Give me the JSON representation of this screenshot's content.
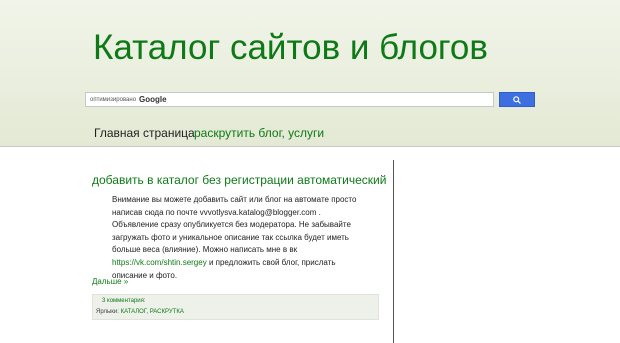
{
  "header": {
    "site_title": "Каталог сайтов и блогов",
    "search": {
      "hint": "оптимизировано",
      "brand": "Google"
    },
    "nav": [
      {
        "label": "Главная страница"
      },
      {
        "label": "раскрутить блог, услуги"
      }
    ]
  },
  "post": {
    "title": "добавить в каталог без регистрации автоматический",
    "body_text": "Внимание вы можете добавить сайт или блог на автомате просто написав сюда по почте vvvotlysva.katalog@blogger.com . Объявление сразу опубликуется без модератора. Не забывайте загружать фото и уникальное описание так ссылка будет иметь больше веса (влияние). Можно написать мне в вк",
    "vk_link": "https://vk.com/shtin.sergey",
    "body_tail": "и предложить свой блог, прислать описание и фото.",
    "more_link": "Дальше »",
    "comments": "3 комментария:",
    "labels_prefix": "Ярлыки:",
    "labels": [
      "КАТАЛОГ",
      "РАСКРУТКА"
    ]
  },
  "colors": {
    "accent": "#0d7a16",
    "header_bg": "#e9eedd",
    "search_button": "#3d6fe0"
  }
}
